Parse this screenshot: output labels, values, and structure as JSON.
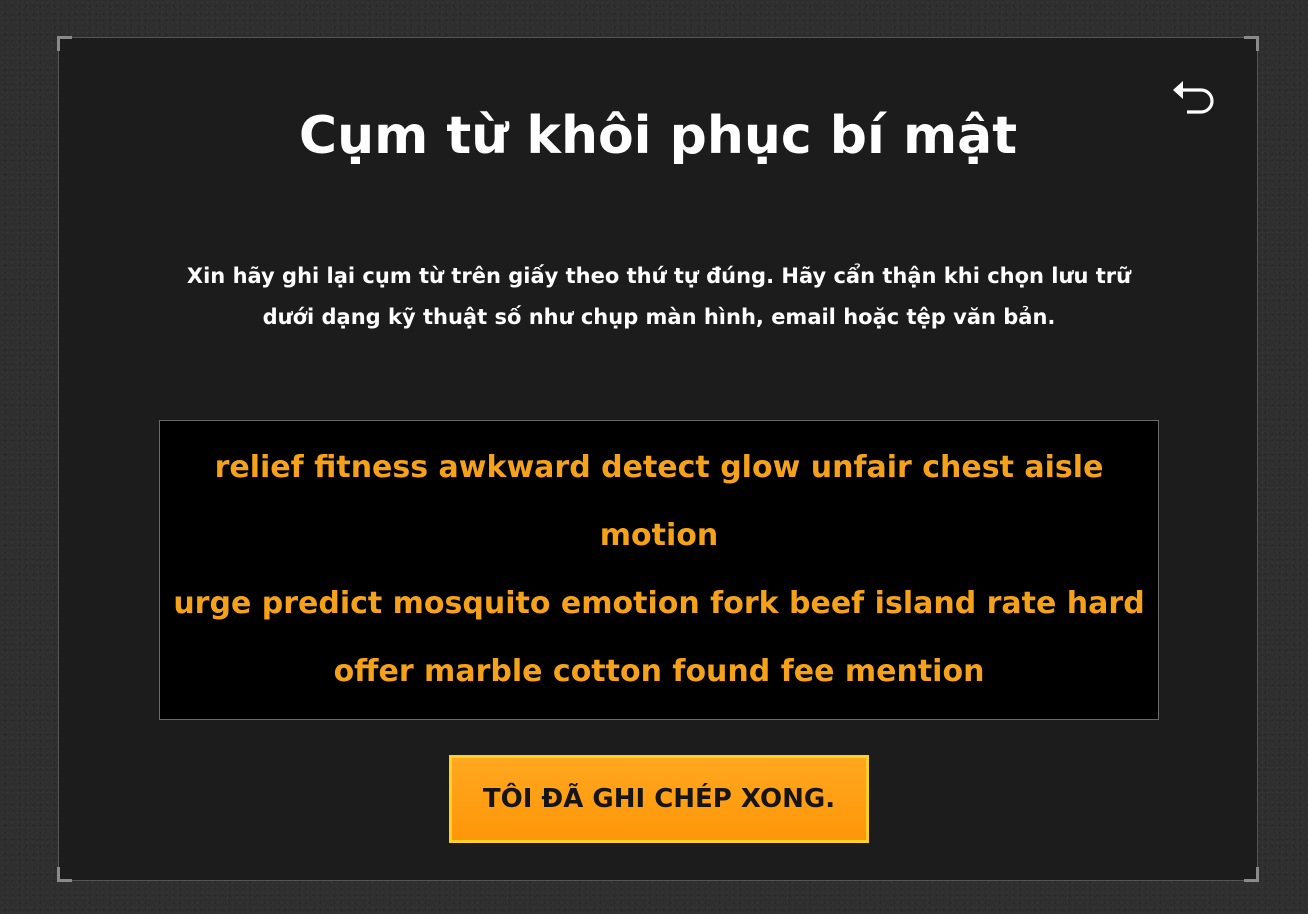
{
  "header": {
    "title": "Cụm từ khôi phục bí mật",
    "back_icon": "undo-arrow-icon"
  },
  "instructions": {
    "line1": "Xin hãy ghi lại cụm từ trên giấy theo thứ tự đúng. Hãy cẩn thận khi chọn lưu trữ",
    "line2": "dưới dạng kỹ thuật số như chụp màn hình, email hoặc tệp văn bản."
  },
  "phrase": {
    "line1": "relief fitness awkward detect glow unfair chest aisle motion",
    "line2": "urge predict mosquito emotion fork beef island rate hard",
    "line3": "offer marble cotton found fee mention"
  },
  "actions": {
    "confirm_label": "TÔI ĐÃ GHI CHÉP XONG."
  },
  "colors": {
    "phrase_text": "#f5a21a",
    "button_fill": "#ff9f14",
    "button_border": "#ffd026",
    "panel_bg": "#1c1c1c",
    "phrase_bg": "#000000"
  }
}
